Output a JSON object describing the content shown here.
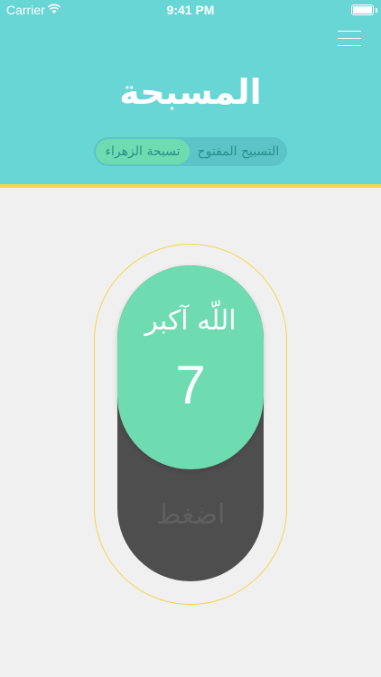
{
  "status_bar": {
    "carrier": "Carrier",
    "time": "9:41 PM"
  },
  "header": {
    "title": "المسبحة",
    "menu_icon": "hamburger-menu-icon"
  },
  "mode_selector": {
    "options": [
      {
        "label": "التسبيح المفتوح",
        "selected": false
      },
      {
        "label": "تسبحة الزهراء",
        "selected": true
      }
    ]
  },
  "counter": {
    "dhikr": "اللّه آكبر",
    "count": "7",
    "press_label": "اضغط"
  },
  "colors": {
    "header": "#69d6d6",
    "accent_green": "#6fdbb1",
    "accent_yellow": "#f6d64a",
    "track": "#4e4e4e",
    "background": "#eff0ef"
  }
}
